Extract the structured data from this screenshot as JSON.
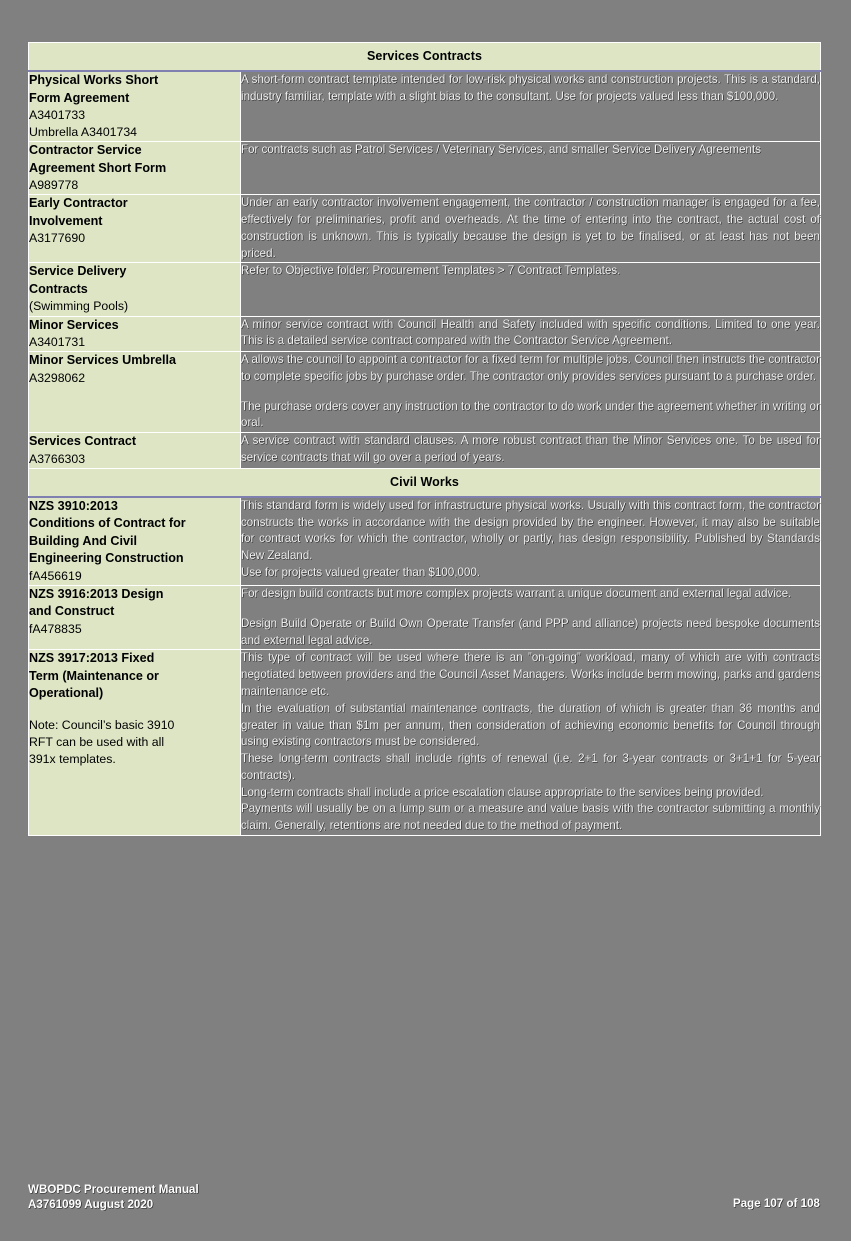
{
  "document": {
    "sections": [
      {
        "heading": "Services Contracts",
        "rows": [
          {
            "title_lines": [
              "Physical Works Short",
              "Form Agreement"
            ],
            "sub_lines": [
              "A3401733",
              "Umbrella A3401734"
            ],
            "paragraphs": [
              "A short-form contract template intended for low-risk physical works and construction projects. This is a standard, industry familiar, template with a slight bias to the consultant. Use for projects valued less than $100,000."
            ]
          },
          {
            "title_lines": [
              "Contractor Service",
              "Agreement Short Form"
            ],
            "sub_lines": [
              "A989778"
            ],
            "paragraphs": [
              "For contracts such as Patrol Services / Veterinary Services, and smaller Service Delivery Agreements"
            ]
          },
          {
            "title_lines": [
              "Early Contractor",
              "Involvement"
            ],
            "sub_lines": [
              "A3177690"
            ],
            "paragraphs": [
              "Under an early contractor involvement engagement, the contractor / construction manager is engaged for a fee, effectively for preliminaries, profit and overheads. At the time of entering into the contract, the actual cost of construction is unknown. This is typically because the design is yet to be finalised, or at least has not been priced."
            ]
          },
          {
            "title_lines": [
              "Service Delivery",
              "Contracts"
            ],
            "sub_lines": [
              "(Swimming Pools)"
            ],
            "paragraphs": [
              "Refer to Objective folder: Procurement Templates > 7 Contract Templates."
            ]
          },
          {
            "title_lines": [
              "Minor Services"
            ],
            "sub_lines": [
              "A3401731"
            ],
            "paragraphs": [
              "A minor service contract with Council Health and Safety included with specific conditions. Limited to one year. This is a detailed service contract compared with the Contractor Service Agreement."
            ]
          },
          {
            "title_lines": [
              "Minor Services Umbrella"
            ],
            "sub_lines": [
              "A3298062"
            ],
            "paragraphs": [
              "A allows the council to appoint a contractor for a fixed term for multiple jobs. Council then instructs the contractor to complete specific jobs by purchase order. The contractor only provides services pursuant to a purchase order.",
              "The purchase orders cover any instruction to the contractor to do work under the agreement whether in writing or oral."
            ]
          },
          {
            "title_lines": [
              "Services Contract"
            ],
            "sub_lines": [
              "A3766303"
            ],
            "paragraphs": [
              "A service contract with standard clauses. A more robust contract than the Minor Services one.  To be used for service contracts that will go over a period of years."
            ]
          }
        ]
      },
      {
        "heading": "Civil Works",
        "rows": [
          {
            "title_lines": [
              "NZS 3910:2013",
              "Conditions of Contract for",
              "Building And Civil",
              "Engineering Construction"
            ],
            "sub_lines": [
              "fA456619"
            ],
            "paragraphs": [
              "This standard form is widely used for infrastructure physical works. Usually with this contract form, the contractor constructs the works in accordance with the design provided by the engineer. However, it may also be suitable for contract works for which the contractor, wholly or partly, has design responsibility. Published by Standards New Zealand."
            ],
            "extra_lines": [
              "Use for projects valued greater than $100,000."
            ]
          },
          {
            "title_lines": [
              "NZS 3916:2013 Design",
              "and Construct"
            ],
            "sub_lines": [
              "fA478835"
            ],
            "paragraphs": [
              "For design build contracts but more complex projects warrant a unique document and external legal advice.",
              "Design Build Operate or Build Own Operate Transfer (and PPP and alliance) projects need bespoke documents and external legal advice."
            ]
          },
          {
            "title_lines": [
              "NZS 3917:2013 Fixed",
              "Term (Maintenance or",
              "Operational)"
            ],
            "sub_lines": [],
            "note_lines": [
              "Note: Council’s basic 3910",
              "RFT can be used with all",
              "391x templates."
            ],
            "paragraphs": [
              "This type of contract will be used where there is an ”on-going” workload, many of which are with contracts negotiated between providers and the Council Asset Managers. Works include berm mowing, parks and gardens maintenance etc.",
              "In the evaluation of substantial maintenance contracts, the duration of which is greater than 36 months and greater in value than $1m per annum, then consideration of achieving economic benefits for Council through using existing contractors must be considered.",
              "These long-term contracts shall include rights of renewal (i.e. 2+1 for 3-year contracts or 3+1+1 for 5-year contracts).",
              "Long-term contracts shall include a price escalation clause appropriate to the services being provided.",
              "Payments will usually be on a lump sum or a measure and value basis with the contractor submitting a monthly claim. Generally, retentions are not needed due to the method of payment."
            ]
          }
        ]
      }
    ]
  },
  "footer": {
    "line1": "WBOPDC Procurement Manual",
    "line2": "A3761099 August 2020",
    "page_label": "Page 107 of 108"
  },
  "colors": {
    "page_background": "#808080",
    "label_cell": "#dde5c5",
    "description_cell": "#808080",
    "border": "#ffffff",
    "section_rule": "#8080b0",
    "description_text": "#f2f2f2",
    "label_text": "#000000"
  }
}
